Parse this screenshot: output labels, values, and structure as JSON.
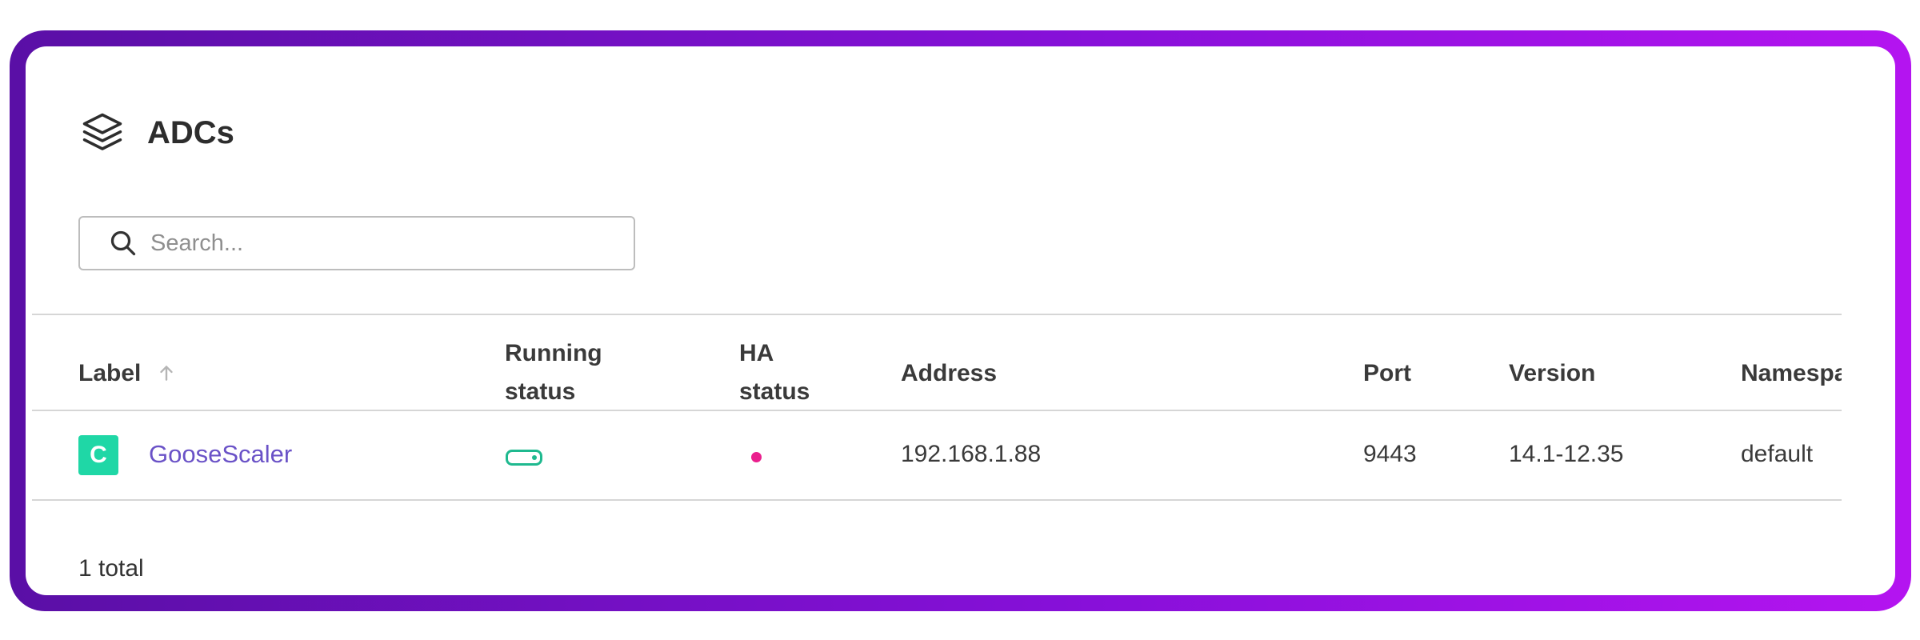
{
  "header": {
    "title": "ADCs",
    "icon": "layers-icon"
  },
  "search": {
    "placeholder": "Search..."
  },
  "table": {
    "columns": {
      "label": "Label",
      "running_status_1": "Running",
      "running_status_2": "status",
      "ha_status_1": "HA",
      "ha_status_2": "status",
      "address": "Address",
      "port": "Port",
      "version": "Version",
      "namespace": "Namespac"
    },
    "rows": [
      {
        "badge": "C",
        "label": "GooseScaler",
        "running_status": "running",
        "ha_status": "down",
        "address": "192.168.1.88",
        "port": "9443",
        "version": "14.1-12.35",
        "namespace": "default"
      }
    ]
  },
  "footer": {
    "total": "1 total"
  },
  "colors": {
    "frame_start": "#5a0fa6",
    "frame_end": "#b414f0",
    "badge": "#1fd7a6",
    "link": "#6a52c7",
    "running_ok": "#1fb98f",
    "ha_alert": "#ea1f8d"
  }
}
